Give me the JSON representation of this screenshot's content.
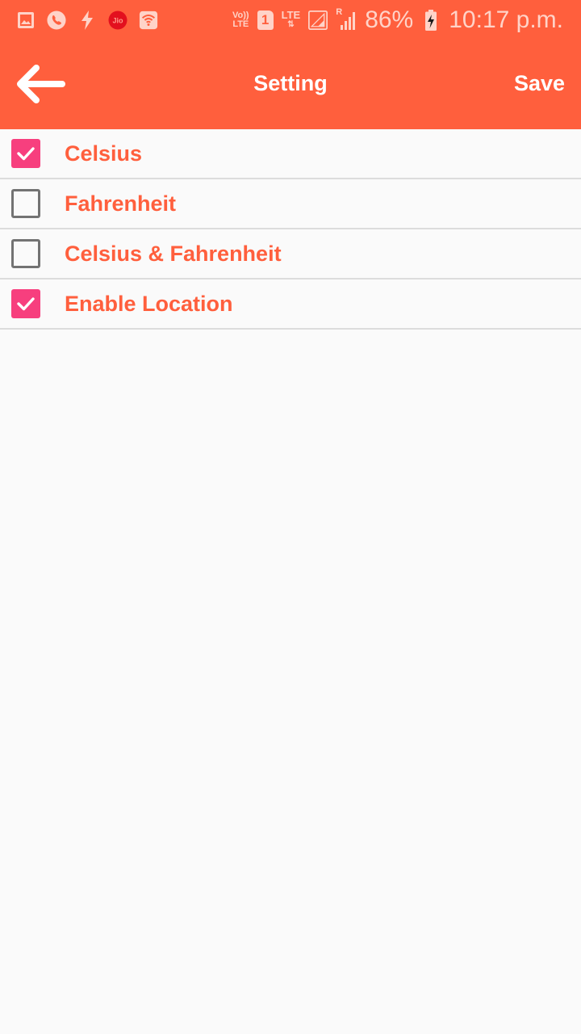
{
  "status_bar": {
    "network_label": "Jio",
    "volte_top": "Vo))",
    "volte_bottom": "LTE",
    "sim_slot": "1",
    "lte_label": "LTE",
    "roaming_label": "R",
    "battery_percent": "86%",
    "time": "10:17 p.m.",
    "icons": [
      "gallery-icon",
      "phone-call-icon",
      "flash-icon",
      "jio-icon",
      "wifi-icon",
      "volte-icon",
      "sim-1-icon",
      "lte-icon",
      "signal-icon",
      "roaming-signal-icon",
      "battery-charging-icon"
    ]
  },
  "app_bar": {
    "back_icon": "arrow-back-icon",
    "title": "Setting",
    "save_label": "Save",
    "color": "#ff5f3d"
  },
  "settings": {
    "items": [
      {
        "label": "Celsius",
        "checked": true
      },
      {
        "label": "Fahrenheit",
        "checked": false
      },
      {
        "label": "Celsius & Fahrenheit",
        "checked": false
      },
      {
        "label": "Enable Location",
        "checked": true
      }
    ],
    "checked_color": "#f73f7e",
    "label_color": "#ff5f3d"
  }
}
